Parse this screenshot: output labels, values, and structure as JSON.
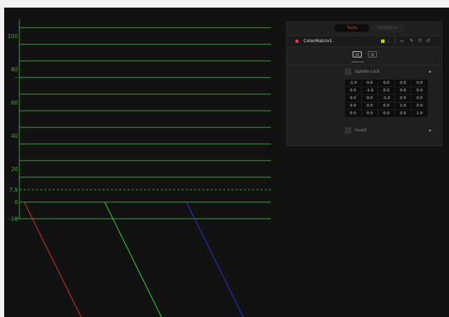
{
  "scope": {
    "y_ticks": [
      "100",
      "80",
      "60",
      "40",
      "20",
      "7.5",
      "0",
      "-10"
    ],
    "gridline_values": [
      105,
      95,
      85,
      75,
      65,
      55,
      45,
      35,
      25,
      15
    ],
    "dashed_values": [
      75,
      7.5
    ],
    "solid_values": [
      0
    ],
    "traces": [
      {
        "color": "#e03030",
        "name": "red"
      },
      {
        "color": "#30e030",
        "name": "green"
      },
      {
        "color": "#3030e0",
        "name": "blue"
      }
    ]
  },
  "inspector": {
    "tabs": {
      "tools": "Tools",
      "modifiers": "Modifiers"
    },
    "node": {
      "name": "ColorMatrix1",
      "color_swatch": "#c5d400",
      "status_dot": "#e0433b"
    },
    "header_icons": [
      "chevron-down-icon",
      "window-icon",
      "pin-icon",
      "lock-icon",
      "reset-icon"
    ],
    "subtabs": [
      "controls-tab-icon",
      "settings-tab-icon"
    ],
    "update_lock_label": "Update Lock",
    "invert_label": "Invert",
    "matrix": [
      [
        "-1.0",
        "0.0",
        "0.0",
        "0.0",
        "0.0"
      ],
      [
        "0.0",
        "-1.0",
        "0.0",
        "0.0",
        "0.0"
      ],
      [
        "0.0",
        "0.0",
        "-1.0",
        "0.0",
        "0.0"
      ],
      [
        "0.0",
        "0.0",
        "0.0",
        "1.0",
        "0.0"
      ],
      [
        "0.0",
        "0.0",
        "0.0",
        "0.0",
        "1.0"
      ]
    ]
  }
}
